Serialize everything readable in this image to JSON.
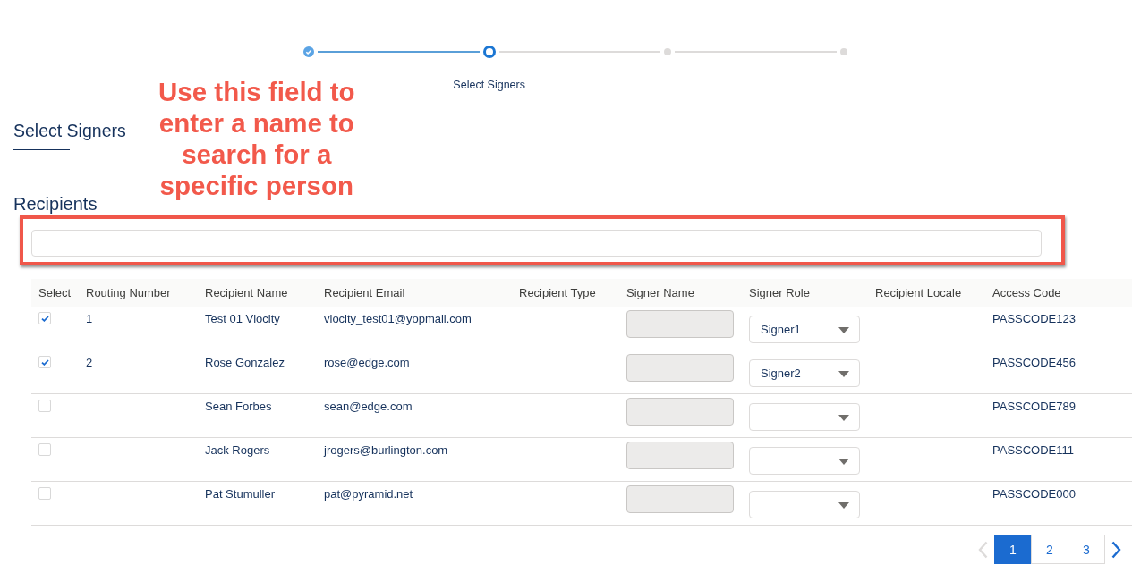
{
  "progress": {
    "steps": [
      {
        "completed": true,
        "selected": false
      },
      {
        "completed": false,
        "selected": true,
        "label": "Select Signers"
      },
      {
        "completed": false,
        "selected": false
      },
      {
        "completed": false,
        "selected": false
      }
    ]
  },
  "section_title": "Select Signers",
  "annotation": {
    "text": "Use this field to\nenter a name to\nsearch for a\nspecific person"
  },
  "recipients": {
    "title": "Recipients",
    "search": {
      "highlighted": true
    }
  },
  "table": {
    "columns": [
      "Select",
      "Routing Number",
      "Recipient Name",
      "Recipient Email",
      "Recipient Type",
      "Signer Name",
      "Signer Role",
      "Recipient Locale",
      "Access Code"
    ],
    "rows": [
      {
        "checked": true,
        "routing_number": "1",
        "recipient_name": "Test 01 Vlocity",
        "recipient_email": "vlocity_test01@yopmail.com",
        "signer_name_disabled": true,
        "signer_role": "Signer1",
        "access_code": "PASSCODE123"
      },
      {
        "checked": true,
        "routing_number": "2",
        "recipient_name": "Rose Gonzalez",
        "recipient_email": "rose@edge.com",
        "signer_name_disabled": true,
        "signer_role": "Signer2",
        "access_code": "PASSCODE456"
      },
      {
        "checked": false,
        "recipient_name": "Sean Forbes",
        "recipient_email": "sean@edge.com",
        "signer_name_disabled": true,
        "access_code": "PASSCODE789"
      },
      {
        "checked": false,
        "recipient_name": "Jack Rogers",
        "recipient_email": "jrogers@burlington.com",
        "signer_name_disabled": true,
        "access_code": "PASSCODE111"
      },
      {
        "checked": false,
        "recipient_name": "Pat Stumuller",
        "recipient_email": "pat@pyramid.net",
        "signer_name_disabled": true,
        "access_code": "PASSCODE000"
      }
    ]
  },
  "pagination": {
    "previous": {
      "disabled": true
    },
    "pages": [
      {
        "label": "1",
        "selected": true
      },
      {
        "label": "2",
        "selected": false
      },
      {
        "label": "3",
        "selected": false
      }
    ],
    "next": {
      "disabled": false
    }
  }
}
